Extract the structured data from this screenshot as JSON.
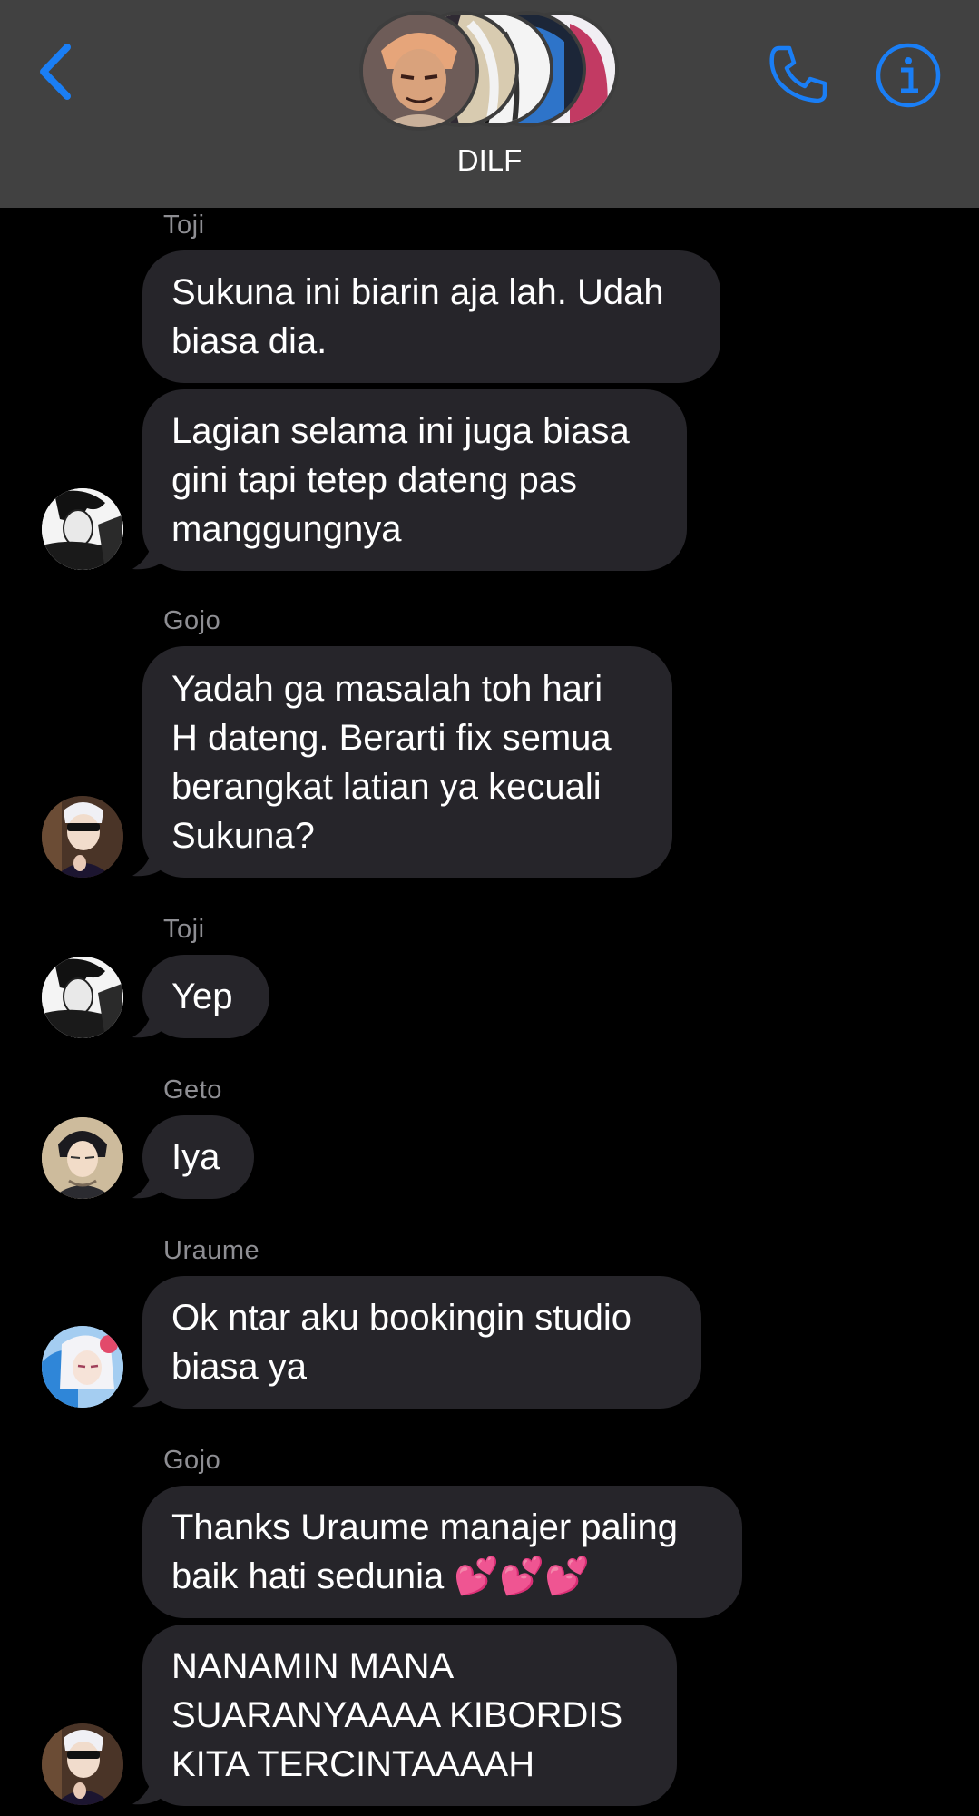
{
  "header": {
    "group_name": "DILF",
    "back_icon": "chevron-left-icon",
    "call_icon": "phone-icon",
    "info_icon": "info-icon",
    "accent_color": "#1a7ef5",
    "background_color": "#414141"
  },
  "theme": {
    "background": "#000000",
    "bubble_color": "#26252a",
    "sender_color": "#8e8e93",
    "text_color": "#ffffff"
  },
  "messages": [
    {
      "sender": "Toji",
      "text": "Sukuna ini biarin aja lah. Udah\nbiasa dia."
    },
    {
      "text": "Lagian selama ini juga biasa\ngini tapi tetep dateng pas\nmanggungnya"
    },
    {
      "sender": "Gojo",
      "text": "Yadah ga masalah toh hari\nH dateng. Berarti fix semua\nberangkat latian ya kecuali\nSukuna?"
    },
    {
      "sender": "Toji",
      "text": "Yep"
    },
    {
      "sender": "Geto",
      "text": "Iya"
    },
    {
      "sender": "Uraume",
      "text": "Ok ntar aku bookingin studio\nbiasa ya"
    },
    {
      "sender": "Gojo",
      "text": "Thanks Uraume manajer paling\nbaik hati sedunia 💕💕💕"
    },
    {
      "text": "NANAMIN MANA\nSUARANYAAAA KIBORDIS\nKITA TERCINTAAAAH"
    }
  ]
}
